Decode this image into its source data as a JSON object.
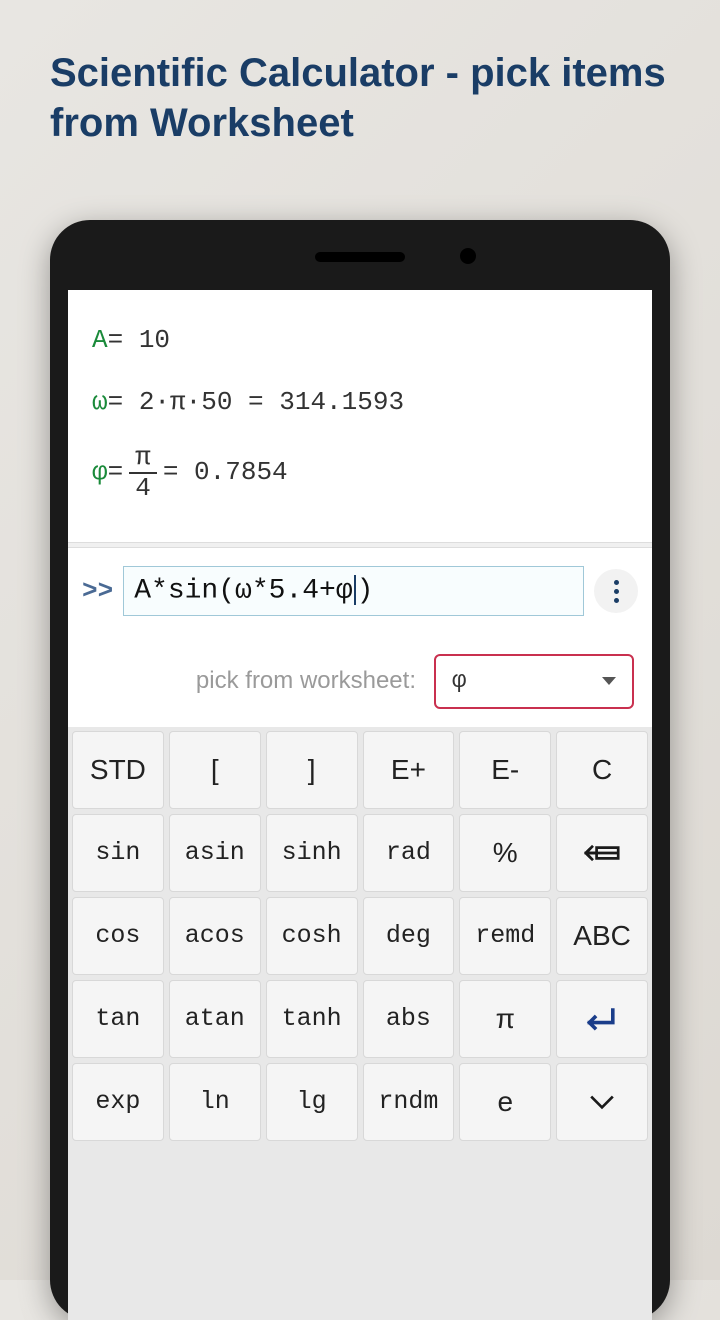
{
  "title": "Scientific Calculator - pick items from Worksheet",
  "worksheet": {
    "line1": {
      "var": "A",
      "expr": " = 10"
    },
    "line2": {
      "var": "ω",
      "expr": " = 2·π·50 = 314.1593"
    },
    "line3": {
      "var": "φ",
      "eq": " = ",
      "frac_top": "π",
      "frac_bot": "4",
      "result": " = 0.7854"
    }
  },
  "input": {
    "prompt": ">>",
    "before_cursor": "A*sin(ω*5.4+φ",
    "after_cursor": ")"
  },
  "picker": {
    "label": "pick from worksheet:",
    "value": "φ"
  },
  "keys": {
    "r1c1": "STD",
    "r1c2": "[",
    "r1c3": "]",
    "r1c4": "E+",
    "r1c5": "E-",
    "r1c6": "C",
    "r2c1": "sin",
    "r2c2": "asin",
    "r2c3": "sinh",
    "r2c4": "rad",
    "r2c5": "%",
    "r3c1": "cos",
    "r3c2": "acos",
    "r3c3": "cosh",
    "r3c4": "deg",
    "r3c5": "remd",
    "r3c6": "ABC",
    "r4c1": "tan",
    "r4c2": "atan",
    "r4c3": "tanh",
    "r4c4": "abs",
    "r4c5": "π",
    "r5c1": "exp",
    "r5c2": "ln",
    "r5c3": "lg",
    "r5c4": "rndm",
    "r5c5": "e"
  }
}
